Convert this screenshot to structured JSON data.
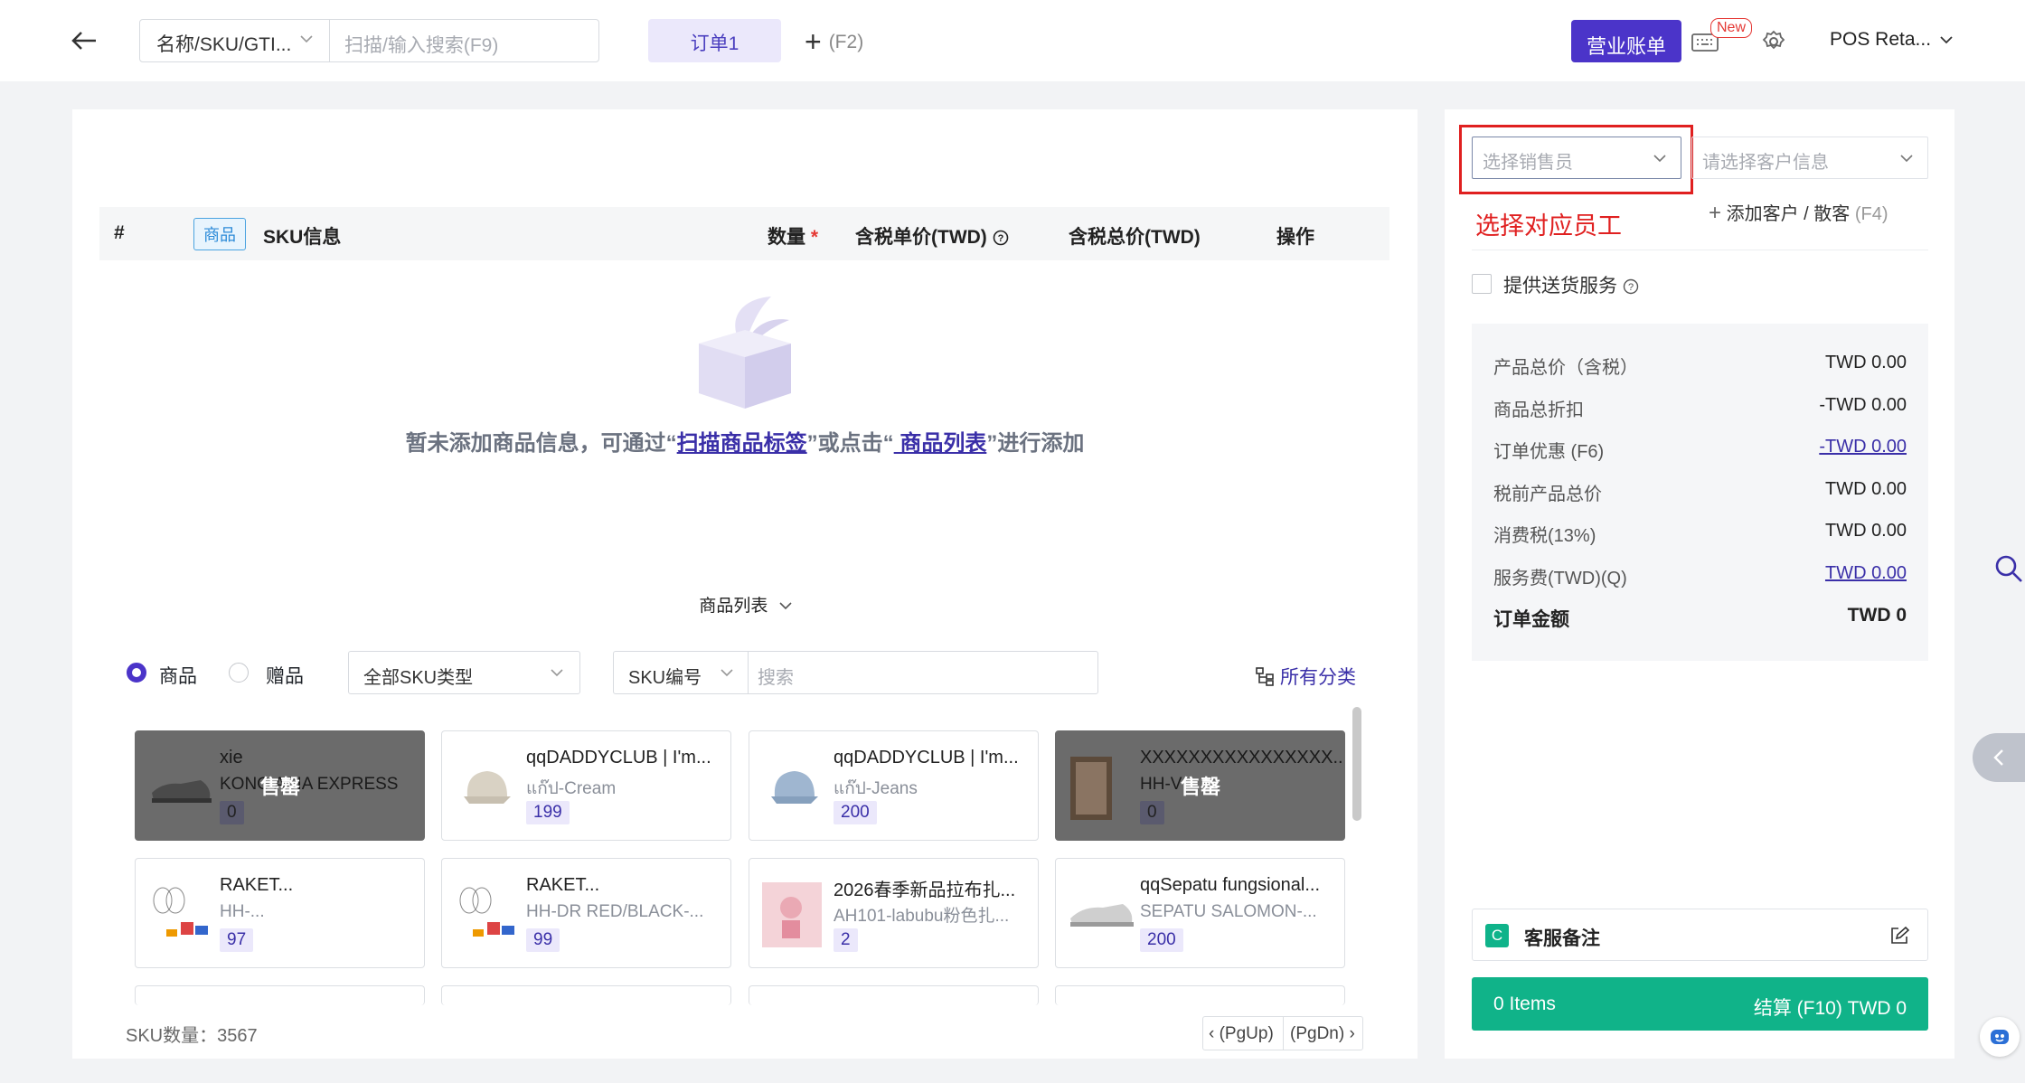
{
  "header": {
    "search_type": "名称/SKU/GTI...",
    "search_placeholder": "扫描/输入搜索(F9)",
    "order_tab": "订单1",
    "add_tab_hint": "(F2)",
    "business_button": "营业账单",
    "new_badge": "New",
    "store_name": "POS Reta..."
  },
  "order_table": {
    "columns": {
      "index": "#",
      "goods_tag": "商品",
      "sku_info": "SKU信息",
      "quantity": "数量",
      "required_mark": "*",
      "unit_price": "含税单价(TWD)",
      "total_price": "含税总价(TWD)",
      "actions": "操作"
    },
    "empty": {
      "prefix": "暂未添加商品信息，可通过“",
      "scan_link": "扫描商品标签",
      "middle": "”或点击“",
      "list_link": " 商品列表",
      "suffix": "”进行添加"
    }
  },
  "product_list": {
    "tab_label": "商品列表",
    "radio_goods": "商品",
    "radio_gift": "赠品",
    "sku_type": "全部SKU类型",
    "sku_field": "SKU编号",
    "search_placeholder": "搜索",
    "all_categories": "所有分类",
    "sku_count": "SKU数量：3567",
    "pg_up": "(PgUp)",
    "pg_dn": "(PgDn)",
    "sold_out_label": "售罄",
    "cards": [
      {
        "name": "xie",
        "sub": "KONG ASIA EXPRESS",
        "qty": "0",
        "sold_out": true
      },
      {
        "name": "qqDADDYCLUB | I'm...",
        "sub": "แก๊ป-Cream",
        "qty": "199",
        "sold_out": false
      },
      {
        "name": "qqDADDYCLUB | I'm...",
        "sub": "แก๊ป-Jeans",
        "qty": "200",
        "sold_out": false
      },
      {
        "name": "XXXXXXXXXXXXXXXX...",
        "sub": "HH-V",
        "qty": "0",
        "sold_out": true
      },
      {
        "name": "RAKET...",
        "sub": "HH-...",
        "qty": "97",
        "sold_out": false
      },
      {
        "name": "RAKET...",
        "sub": "HH-DR RED/BLACK-...",
        "qty": "99",
        "sold_out": false
      },
      {
        "name": "2026春季新品拉布扎...",
        "sub": "AH101-labubu粉色扎...",
        "qty": "2",
        "sold_out": false
      },
      {
        "name": "qqSepatu fungsional...",
        "sub": "SEPATU SALOMON-...",
        "qty": "200",
        "sold_out": false
      }
    ]
  },
  "right_panel": {
    "sales_placeholder": "选择销售员",
    "customer_placeholder": "请选择客户信息",
    "annotation": "选择对应员工",
    "add_customer": "添加客户",
    "slash": "/",
    "walk_in": "散客",
    "walk_in_key": "(F4)",
    "delivery": "提供送货服务",
    "summary": [
      {
        "label": "产品总价（含税）",
        "value": "TWD 0.00",
        "link": false,
        "bold": false
      },
      {
        "label": "商品总折扣",
        "value": "-TWD 0.00",
        "link": false,
        "bold": false
      },
      {
        "label": "订单优惠 (F6)",
        "value": "-TWD 0.00",
        "link": true,
        "bold": false
      },
      {
        "label": "税前产品总价",
        "value": "TWD 0.00",
        "link": false,
        "bold": false
      },
      {
        "label": "消费税(13%)",
        "value": "TWD 0.00",
        "link": false,
        "bold": false
      },
      {
        "label": "服务费(TWD)(Q)",
        "value": "TWD 0.00",
        "link": true,
        "bold": false
      },
      {
        "label": "订单金额",
        "value": "TWD 0",
        "link": false,
        "bold": true
      }
    ],
    "note_icon": "C",
    "note_label": "客服备注",
    "items_count": "0 Items",
    "checkout": "结算 (F10) TWD 0"
  },
  "colors": {
    "accent": "#4b34c9",
    "checkout": "#10b389",
    "annotation": "#e02020"
  }
}
